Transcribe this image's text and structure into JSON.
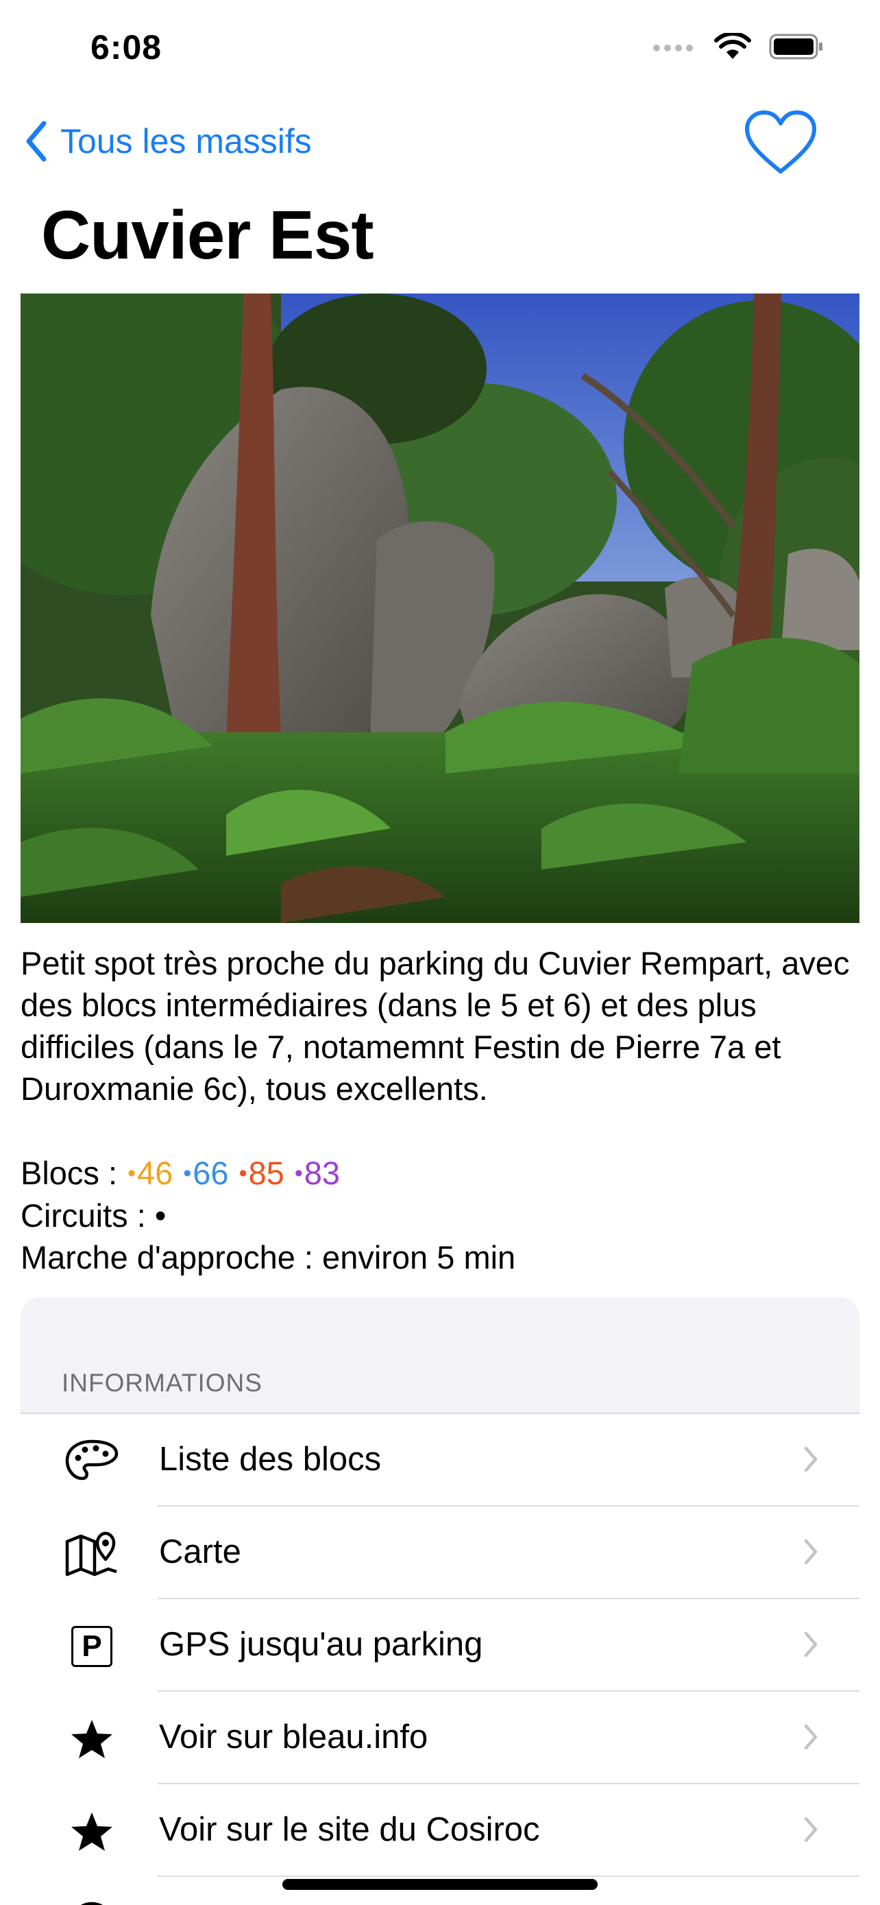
{
  "status_bar": {
    "time": "6:08"
  },
  "nav": {
    "back_label": "Tous les massifs"
  },
  "title": "Cuvier Est",
  "description": "Petit spot très proche du parking du Cuvier Rempart, avec des blocs intermédiaires (dans le 5 et 6) et des plus difficiles (dans le 7, notamemnt Festin de Pierre 7a et Duroxmanie 6c), tous excellents.",
  "stats": {
    "blocs_label": "Blocs : ",
    "blocs": [
      {
        "dot": "•",
        "value": "46",
        "color": "#f2a21b"
      },
      {
        "dot": "•",
        "value": "66",
        "color": "#3a8ee6"
      },
      {
        "dot": "•",
        "value": "85",
        "color": "#f0521b"
      },
      {
        "dot": "•",
        "value": "83",
        "color": "#9b3fd6"
      }
    ],
    "circuits_label": "Circuits : ",
    "circuits_value": "•",
    "approach": "Marche d'approche : environ 5 min"
  },
  "info": {
    "header": "INFORMATIONS",
    "rows": [
      {
        "label": "Liste des blocs",
        "icon": "palette-icon"
      },
      {
        "label": "Carte",
        "icon": "map-icon"
      },
      {
        "label": "GPS jusqu'au parking",
        "icon": "parking-icon",
        "icon_text": "P"
      },
      {
        "label": "Voir sur bleau.info",
        "icon": "star-icon"
      },
      {
        "label": "Voir sur le site du Cosiroc",
        "icon": "star-icon"
      }
    ]
  },
  "colors": {
    "accent": "#1a7df5",
    "grouped_background": "#f2f2f7",
    "separator": "#dcdce0"
  }
}
